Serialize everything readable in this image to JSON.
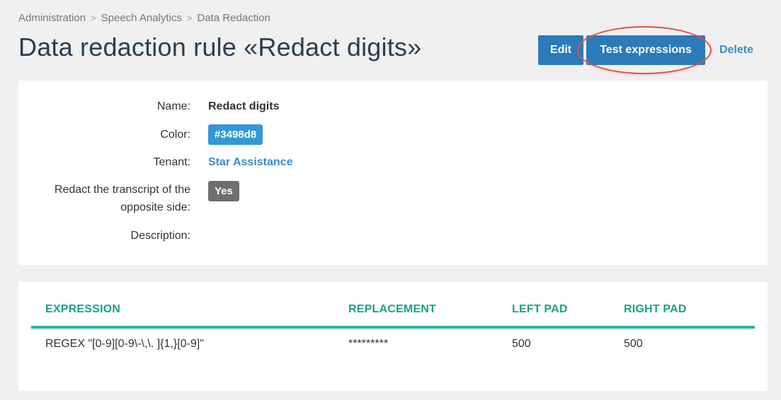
{
  "breadcrumb": {
    "items": [
      "Administration",
      "Speech Analytics",
      "Data Redaction"
    ],
    "separator": ">"
  },
  "page": {
    "title": "Data redaction rule «Redact digits»"
  },
  "actions": {
    "edit_label": "Edit",
    "test_label": "Test expressions",
    "delete_label": "Delete"
  },
  "details": {
    "name_label": "Name:",
    "name_value": "Redact digits",
    "color_label": "Color:",
    "color_value": "#3498d8",
    "tenant_label": "Tenant:",
    "tenant_value": "Star Assistance",
    "redact_label_line1": "Redact the transcript of the",
    "redact_label_line2": "opposite side:",
    "redact_value": "Yes",
    "description_label": "Description:",
    "description_value": ""
  },
  "table": {
    "headers": [
      "EXPRESSION",
      "REPLACEMENT",
      "LEFT PAD",
      "RIGHT PAD"
    ],
    "rows": [
      [
        "REGEX \"[0-9][0-9\\-\\,\\. ]{1,}[0-9]\"",
        "*********",
        "500",
        "500"
      ]
    ]
  },
  "colors": {
    "primary_button": "#2c7ab8",
    "link": "#3a8ccd",
    "color_badge": "#3498d8",
    "yes_badge": "#6f6f6f",
    "table_header": "#1aa382",
    "table_divider": "#2bb79a",
    "highlight": "#d9534f"
  }
}
